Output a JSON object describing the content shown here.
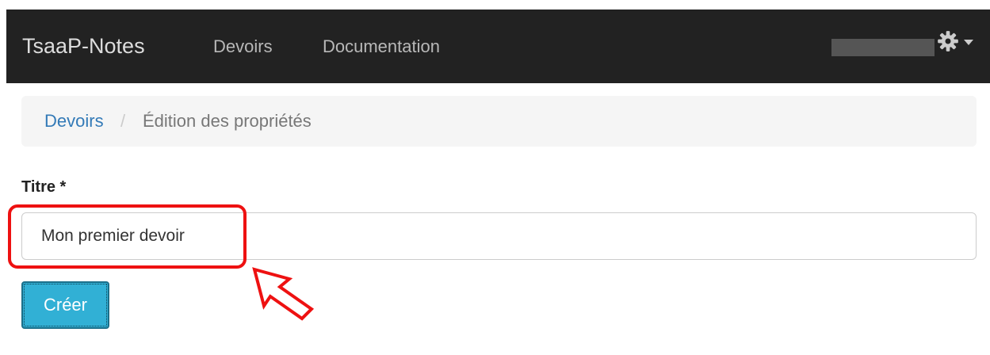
{
  "navbar": {
    "brand": "TsaaP-Notes",
    "links": [
      {
        "label": "Devoirs"
      },
      {
        "label": "Documentation"
      }
    ],
    "settings_icon": "gear-icon",
    "dropdown_icon": "caret-down-icon"
  },
  "breadcrumb": {
    "parent": "Devoirs",
    "separator": "/",
    "current": "Édition des propriétés"
  },
  "form": {
    "title_label": "Titre *",
    "title_value": "Mon premier devoir",
    "submit_label": "Créer"
  },
  "colors": {
    "navbar_bg": "#222222",
    "link": "#337ab7",
    "button": "#31b0d5",
    "annotation": "#ee1111"
  }
}
